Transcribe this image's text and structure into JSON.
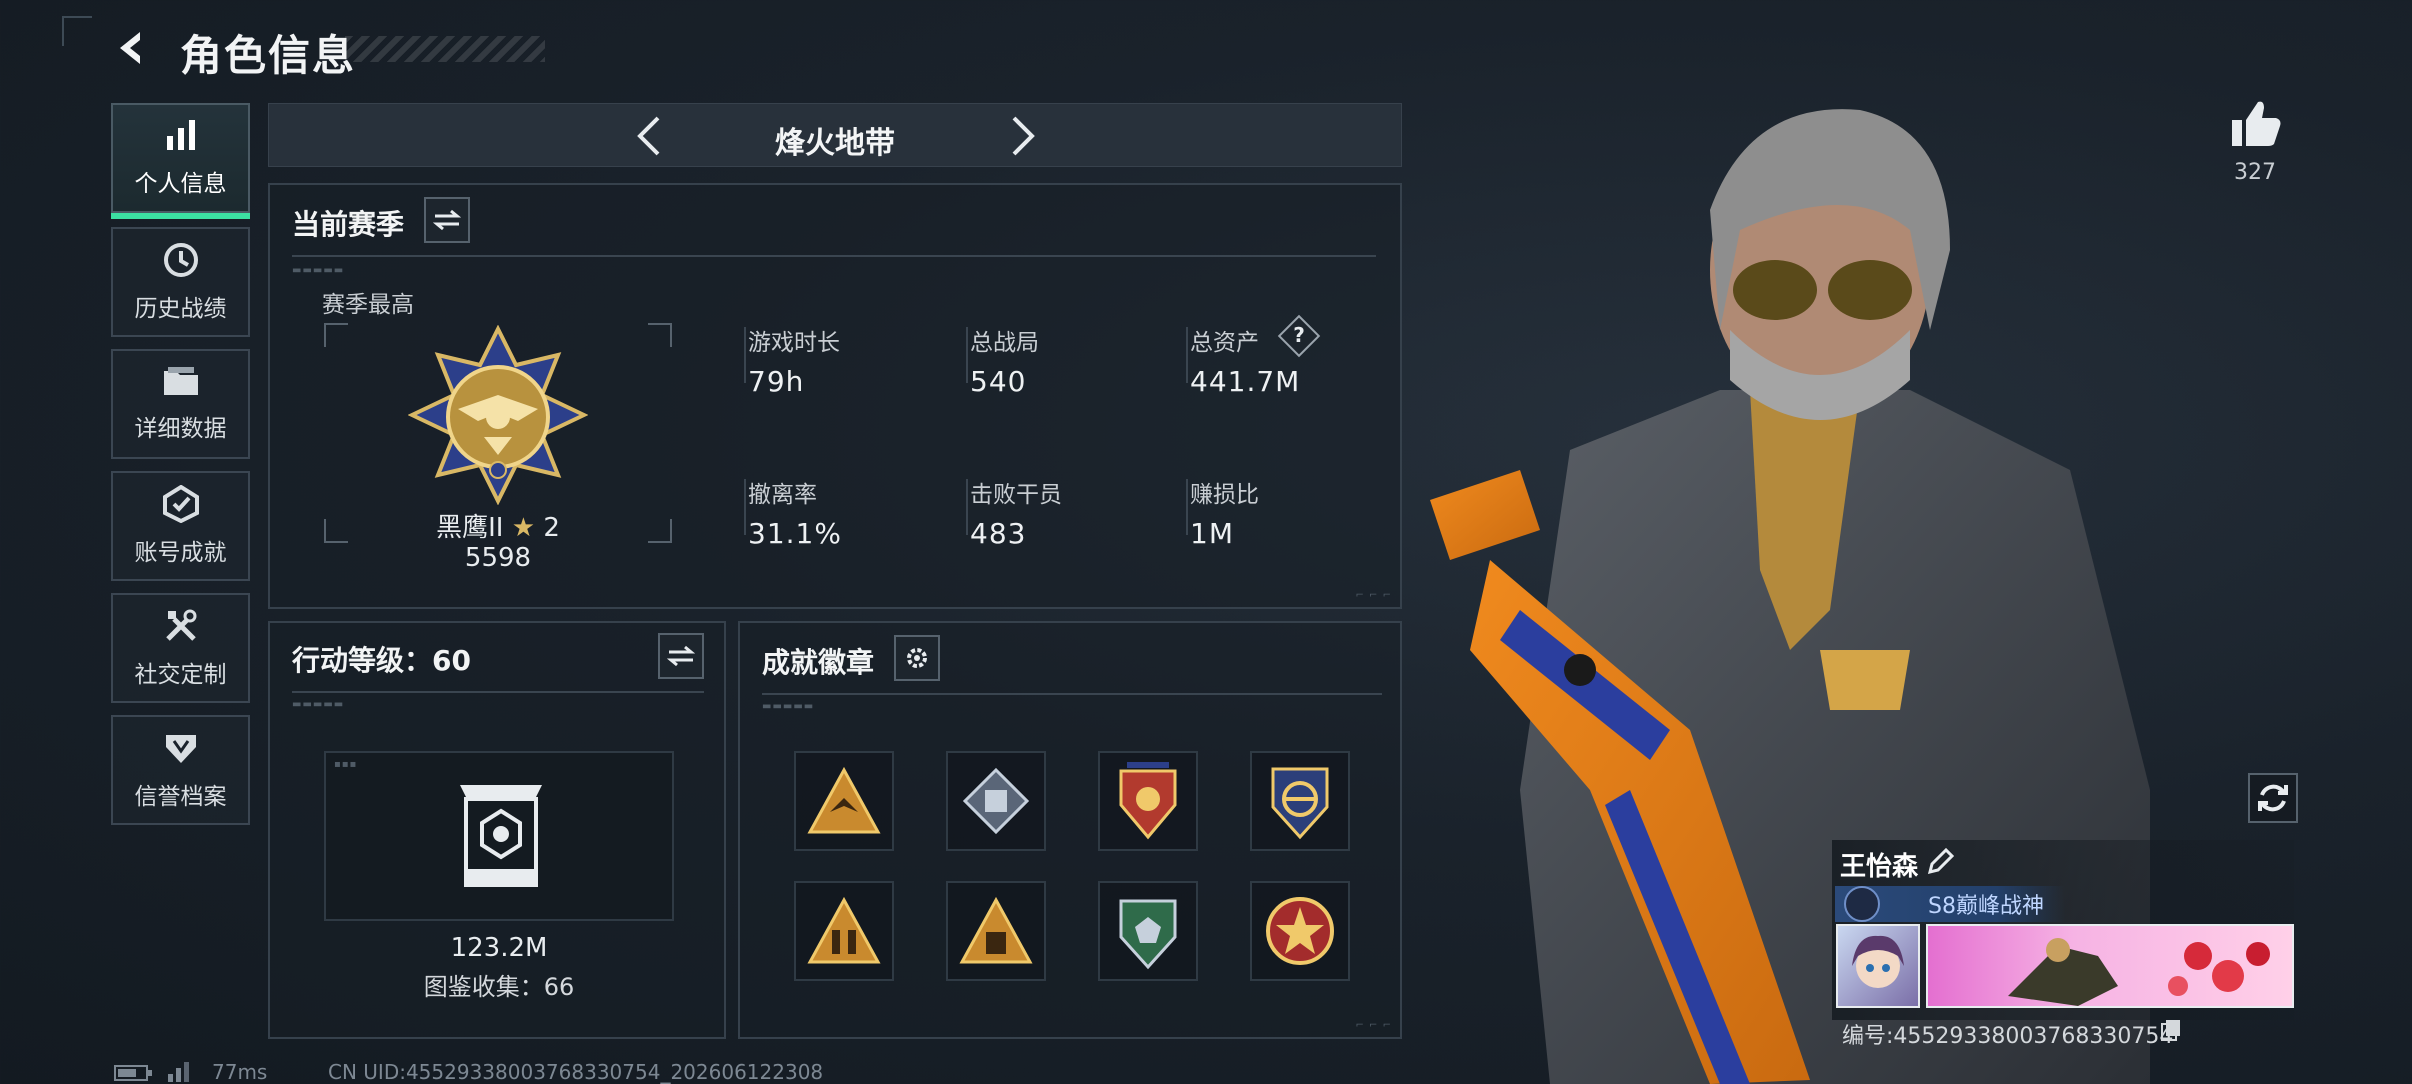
{
  "header": {
    "title": "角色信息"
  },
  "sidebar": {
    "items": [
      {
        "label": "个人信息",
        "icon": "bar-chart-icon",
        "active": true
      },
      {
        "label": "历史战绩",
        "icon": "history-icon",
        "active": false
      },
      {
        "label": "详细数据",
        "icon": "folder-icon",
        "active": false
      },
      {
        "label": "账号成就",
        "icon": "achievement-icon",
        "active": false
      },
      {
        "label": "社交定制",
        "icon": "tools-icon",
        "active": false
      },
      {
        "label": "信誉档案",
        "icon": "reputation-icon",
        "active": false
      }
    ]
  },
  "mode": {
    "title": "烽火地带"
  },
  "season": {
    "title": "当前赛季",
    "best_label": "赛季最高",
    "rank_name": "黑鹰II",
    "rank_stars": "2",
    "rank_score": "5598",
    "stats": [
      {
        "label": "游戏时长",
        "value": "79h"
      },
      {
        "label": "总战局",
        "value": "540"
      },
      {
        "label": "总资产",
        "value": "441.7M",
        "help": "?"
      },
      {
        "label": "撤离率",
        "value": "31.1%"
      },
      {
        "label": "击败干员",
        "value": "483"
      },
      {
        "label": "赚损比",
        "value": "1M"
      }
    ]
  },
  "action_level": {
    "title": "行动等级：60",
    "value": "123.2M",
    "collection": "图鉴收集：66"
  },
  "achievements": {
    "title": "成就徽章",
    "badges": [
      {
        "icon": "triangle-emblem-icon",
        "color": "#c98a2e"
      },
      {
        "icon": "diamond-emblem-icon",
        "color": "#9aa7b8"
      },
      {
        "icon": "shield-emblem-icon",
        "color": "#b23a2e"
      },
      {
        "icon": "navy-shield-emblem-icon",
        "color": "#2c3f7a"
      },
      {
        "icon": "soldiers-triangle-emblem-icon",
        "color": "#c98a2e"
      },
      {
        "icon": "box-triangle-emblem-icon",
        "color": "#c98a2e"
      },
      {
        "icon": "green-shield-emblem-icon",
        "color": "#2f6b4a"
      },
      {
        "icon": "star-medal-emblem-icon",
        "color": "#a32c2c"
      }
    ]
  },
  "profile": {
    "likes": "327",
    "name": "王怡森",
    "title": "S8巅峰战神",
    "id": "编号:4552933800376833​0754"
  },
  "status": {
    "ping": "77ms",
    "uid": "CN UID:45529338003768330754_202606122308"
  },
  "colors": {
    "accent": "#3ce0a2",
    "panel_border": "#36414c"
  }
}
